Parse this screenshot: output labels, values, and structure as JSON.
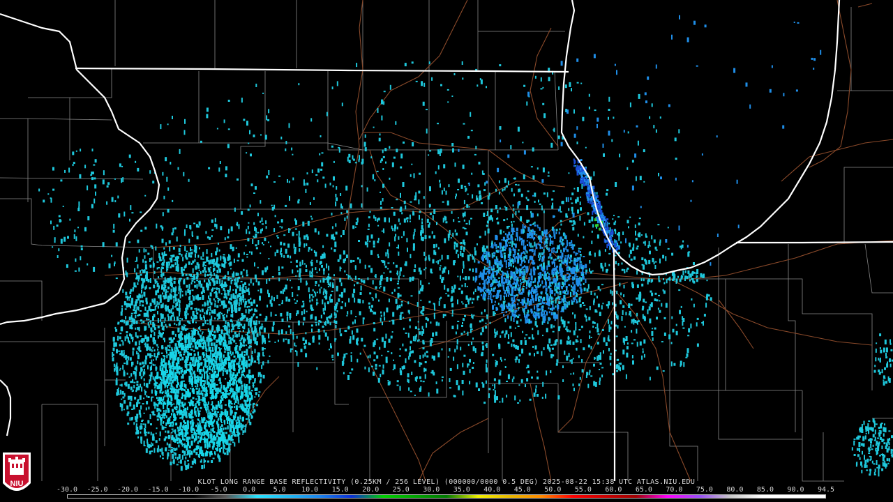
{
  "caption": "KLOT LONG RANGE BASE REFLECTIVITY (0.25KM / 256 LEVEL) (000000/0000 0.5 DEG) 2025-08-22 15:38 UTC  ATLAS.NIU.EDU",
  "colorbar": {
    "ticks": [
      "-30.0",
      "-25.0",
      "-20.0",
      "-15.0",
      "-10.0",
      "-5.0",
      "0.0",
      "5.0",
      "10.0",
      "15.0",
      "20.0",
      "25.0",
      "30.0",
      "35.0",
      "40.0",
      "45.0",
      "50.0",
      "55.0",
      "60.0",
      "65.0",
      "70.0",
      "75.0",
      "80.0",
      "85.0",
      "90.0",
      "94.5"
    ],
    "colors": [
      "#000000",
      "#000000",
      "#000000",
      "#000000",
      "#000000",
      "#555555",
      "#29e3ff",
      "#21b9f2",
      "#1c83ec",
      "#0a2fd6",
      "#00d000",
      "#00a400",
      "#007a00",
      "#f0f000",
      "#e8b800",
      "#ff8a00",
      "#ff0000",
      "#cc0000",
      "#a00000",
      "#ff00ff",
      "#9a4ef7",
      "#c8c8c8",
      "#ffffff",
      "#ffffff",
      "#ffffff"
    ]
  },
  "logo": {
    "text": "NIU",
    "color": "#c8102e"
  },
  "colors": {
    "state_border": "#ffffff",
    "county_line": "#8a8a8a",
    "highway": "#8b4a2a",
    "echo_light": "#1ec8dc",
    "echo_mid": "#1f8ee8",
    "echo_strong": "#1a4ed8",
    "echo_green": "#2fd12f"
  }
}
